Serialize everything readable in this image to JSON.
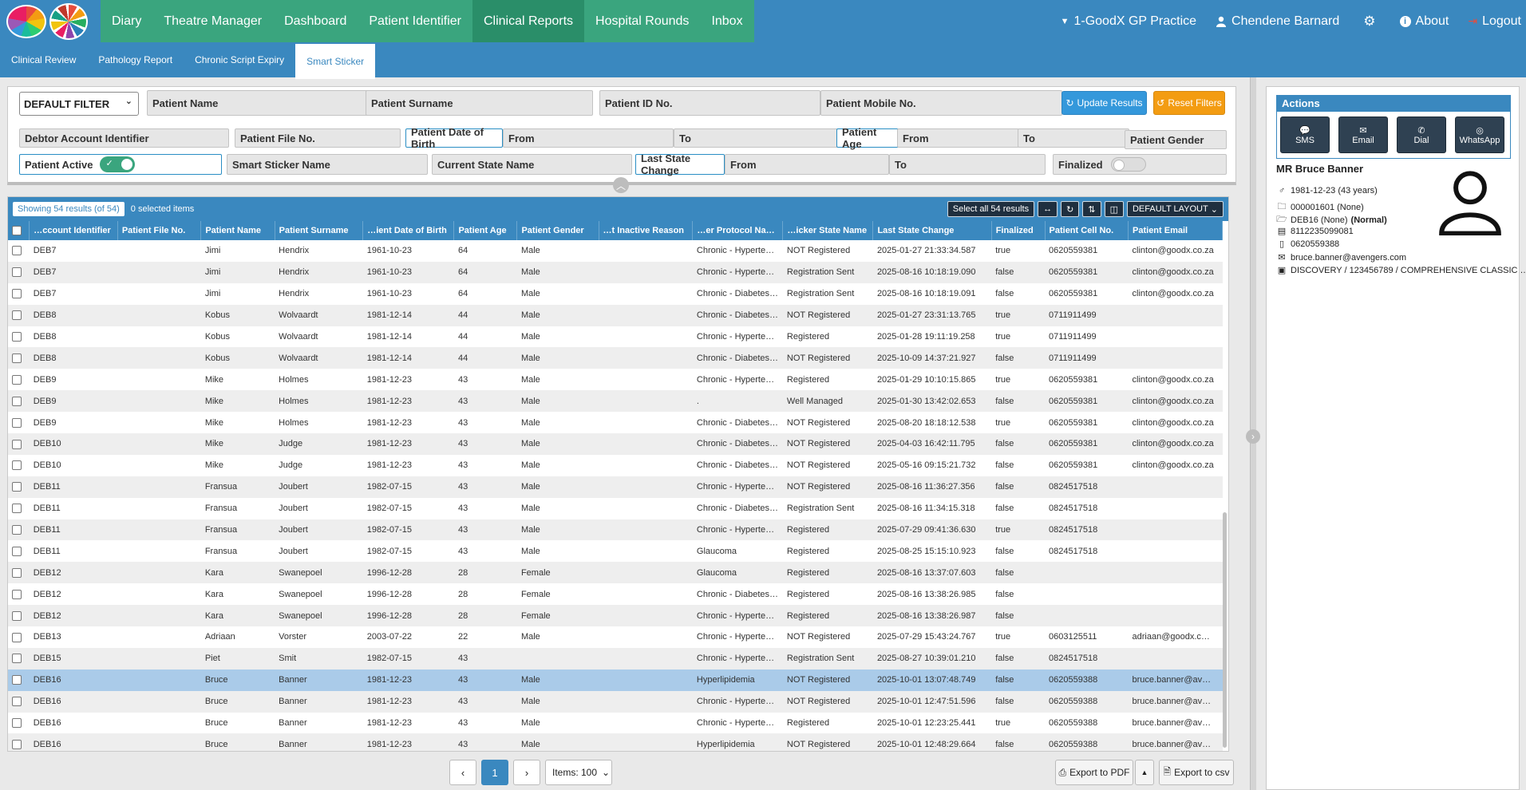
{
  "nav": {
    "items": [
      "Diary",
      "Theatre Manager",
      "Dashboard",
      "Patient Identifier",
      "Clinical Reports",
      "Hospital Rounds",
      "Inbox"
    ],
    "active_index": 4,
    "practice": "1-GoodX GP Practice",
    "user": "Chendene Barnard",
    "about": "About",
    "logout": "Logout"
  },
  "subnav": {
    "items": [
      "Clinical Review",
      "Pathology Report",
      "Chronic Script Expiry",
      "Smart Sticker"
    ],
    "active_index": 3
  },
  "filters": {
    "default_filter": "DEFAULT FILTER",
    "patient_name": "Patient Name",
    "patient_surname": "Patient Surname",
    "patient_id": "Patient ID No.",
    "patient_mobile": "Patient Mobile No.",
    "update_results": "Update Results",
    "reset_filters": "Reset Filters",
    "debtor_account": "Debtor Account Identifier",
    "patient_file": "Patient File No.",
    "patient_dob": "Patient Date of Birth",
    "from": "From",
    "to": "To",
    "patient_age": "Patient Age",
    "patient_gender": "Patient Gender",
    "patient_active": "Patient Active",
    "smart_sticker_name": "Smart Sticker Name",
    "current_state_name": "Current State Name",
    "last_state_change": "Last State Change",
    "finalized": "Finalized"
  },
  "table": {
    "showing": "Showing 54 results (of 54)",
    "selected": "0 selected items",
    "select_all": "Select all 54 results",
    "layout": "DEFAULT LAYOUT",
    "columns": [
      "…ccount Identifier",
      "Patient File No.",
      "Patient Name",
      "Patient Surname",
      "…ient Date of Birth",
      "Patient Age",
      "Patient Gender",
      "…t Inactive Reason",
      "…er Protocol Name",
      "…icker State Name",
      "Last State Change",
      "Finalized",
      "Patient Cell No.",
      "Patient Email"
    ],
    "rows": [
      [
        "DEB7",
        "",
        "Jimi",
        "Hendrix",
        "1961-10-23",
        "64",
        "Male",
        "",
        "Chronic - Hyperte…",
        "NOT Registered",
        "2025-01-27 21:33:34.587",
        "true",
        "0620559381",
        "clinton@goodx.co.za"
      ],
      [
        "DEB7",
        "",
        "Jimi",
        "Hendrix",
        "1961-10-23",
        "64",
        "Male",
        "",
        "Chronic - Hyperte…",
        "Registration Sent",
        "2025-08-16 10:18:19.090",
        "false",
        "0620559381",
        "clinton@goodx.co.za"
      ],
      [
        "DEB7",
        "",
        "Jimi",
        "Hendrix",
        "1961-10-23",
        "64",
        "Male",
        "",
        "Chronic - Diabetes…",
        "Registration Sent",
        "2025-08-16 10:18:19.091",
        "false",
        "0620559381",
        "clinton@goodx.co.za"
      ],
      [
        "DEB8",
        "",
        "Kobus",
        "Wolvaardt",
        "1981-12-14",
        "44",
        "Male",
        "",
        "Chronic - Diabetes…",
        "NOT Registered",
        "2025-01-27 23:31:13.765",
        "true",
        "0711911499",
        ""
      ],
      [
        "DEB8",
        "",
        "Kobus",
        "Wolvaardt",
        "1981-12-14",
        "44",
        "Male",
        "",
        "Chronic - Hyperte…",
        "Registered",
        "2025-01-28 19:11:19.258",
        "true",
        "0711911499",
        ""
      ],
      [
        "DEB8",
        "",
        "Kobus",
        "Wolvaardt",
        "1981-12-14",
        "44",
        "Male",
        "",
        "Chronic - Diabetes…",
        "NOT Registered",
        "2025-10-09 14:37:21.927",
        "false",
        "0711911499",
        ""
      ],
      [
        "DEB9",
        "",
        "Mike",
        "Holmes",
        "1981-12-23",
        "43",
        "Male",
        "",
        "Chronic - Hyperte…",
        "Registered",
        "2025-01-29 10:10:15.865",
        "true",
        "0620559381",
        "clinton@goodx.co.za"
      ],
      [
        "DEB9",
        "",
        "Mike",
        "Holmes",
        "1981-12-23",
        "43",
        "Male",
        "",
        ".",
        "Well Managed",
        "2025-01-30 13:42:02.653",
        "false",
        "0620559381",
        "clinton@goodx.co.za"
      ],
      [
        "DEB9",
        "",
        "Mike",
        "Holmes",
        "1981-12-23",
        "43",
        "Male",
        "",
        "Chronic - Diabetes…",
        "NOT Registered",
        "2025-08-20 18:18:12.538",
        "true",
        "0620559381",
        "clinton@goodx.co.za"
      ],
      [
        "DEB10",
        "",
        "Mike",
        "Judge",
        "1981-12-23",
        "43",
        "Male",
        "",
        "Chronic - Diabetes…",
        "NOT Registered",
        "2025-04-03 16:42:11.795",
        "false",
        "0620559381",
        "clinton@goodx.co.za"
      ],
      [
        "DEB10",
        "",
        "Mike",
        "Judge",
        "1981-12-23",
        "43",
        "Male",
        "",
        "Chronic - Diabetes…",
        "NOT Registered",
        "2025-05-16 09:15:21.732",
        "false",
        "0620559381",
        "clinton@goodx.co.za"
      ],
      [
        "DEB11",
        "",
        "Fransua",
        "Joubert",
        "1982-07-15",
        "43",
        "Male",
        "",
        "Chronic - Hyperte…",
        "NOT Registered",
        "2025-08-16 11:36:27.356",
        "false",
        "0824517518",
        ""
      ],
      [
        "DEB11",
        "",
        "Fransua",
        "Joubert",
        "1982-07-15",
        "43",
        "Male",
        "",
        "Chronic - Diabetes…",
        "Registration Sent",
        "2025-08-16 11:34:15.318",
        "false",
        "0824517518",
        ""
      ],
      [
        "DEB11",
        "",
        "Fransua",
        "Joubert",
        "1982-07-15",
        "43",
        "Male",
        "",
        "Chronic - Hyperte…",
        "Registered",
        "2025-07-29 09:41:36.630",
        "true",
        "0824517518",
        ""
      ],
      [
        "DEB11",
        "",
        "Fransua",
        "Joubert",
        "1982-07-15",
        "43",
        "Male",
        "",
        "Glaucoma",
        "Registered",
        "2025-08-25 15:15:10.923",
        "false",
        "0824517518",
        ""
      ],
      [
        "DEB12",
        "",
        "Kara",
        "Swanepoel",
        "1996-12-28",
        "28",
        "Female",
        "",
        "Glaucoma",
        "Registered",
        "2025-08-16 13:37:07.603",
        "false",
        "",
        ""
      ],
      [
        "DEB12",
        "",
        "Kara",
        "Swanepoel",
        "1996-12-28",
        "28",
        "Female",
        "",
        "Chronic - Diabetes…",
        "Registered",
        "2025-08-16 13:38:26.985",
        "false",
        "",
        ""
      ],
      [
        "DEB12",
        "",
        "Kara",
        "Swanepoel",
        "1996-12-28",
        "28",
        "Female",
        "",
        "Chronic - Hyperte…",
        "Registered",
        "2025-08-16 13:38:26.987",
        "false",
        "",
        ""
      ],
      [
        "DEB13",
        "",
        "Adriaan",
        "Vorster",
        "2003-07-22",
        "22",
        "Male",
        "",
        "Chronic - Hyperte…",
        "NOT Registered",
        "2025-07-29 15:43:24.767",
        "true",
        "0603125511",
        "adriaan@goodx.c…"
      ],
      [
        "DEB15",
        "",
        "Piet",
        "Smit",
        "1982-07-15",
        "43",
        "",
        "",
        "Chronic - Hyperte…",
        "Registration Sent",
        "2025-08-27 10:39:01.210",
        "false",
        "0824517518",
        ""
      ],
      [
        "DEB16",
        "",
        "Bruce",
        "Banner",
        "1981-12-23",
        "43",
        "Male",
        "",
        "Hyperlipidemia",
        "NOT Registered",
        "2025-10-01 13:07:48.749",
        "false",
        "0620559388",
        "bruce.banner@av…"
      ],
      [
        "DEB16",
        "",
        "Bruce",
        "Banner",
        "1981-12-23",
        "43",
        "Male",
        "",
        "Chronic - Hyperte…",
        "NOT Registered",
        "2025-10-01 12:47:51.596",
        "false",
        "0620559388",
        "bruce.banner@av…"
      ],
      [
        "DEB16",
        "",
        "Bruce",
        "Banner",
        "1981-12-23",
        "43",
        "Male",
        "",
        "Chronic - Hyperte…",
        "Registered",
        "2025-10-01 12:23:25.441",
        "true",
        "0620559388",
        "bruce.banner@av…"
      ],
      [
        "DEB16",
        "",
        "Bruce",
        "Banner",
        "1981-12-23",
        "43",
        "Male",
        "",
        "Hyperlipidemia",
        "NOT Registered",
        "2025-10-01 12:48:29.664",
        "false",
        "0620559388",
        "bruce.banner@av…"
      ]
    ],
    "selected_row_index": 20
  },
  "pager": {
    "current_page": "1",
    "items_per_page": "Items: 100",
    "export_pdf": "Export to PDF",
    "export_csv": "Export to csv"
  },
  "patient_panel": {
    "actions_title": "Actions",
    "buttons": [
      "SMS",
      "Email",
      "Dial",
      "WhatsApp"
    ],
    "name": "MR Bruce Banner",
    "dob": "1981-12-23 (43 years)",
    "file": "000001601 (None)",
    "account": "DEB16 (None) ",
    "account_status": "(Normal)",
    "id_no": "8112235099081",
    "cell": "0620559388",
    "email": "bruce.banner@avengers.com",
    "medical_aid": "DISCOVERY / 123456789 / COMPREHENSIVE CLASSIC …"
  }
}
